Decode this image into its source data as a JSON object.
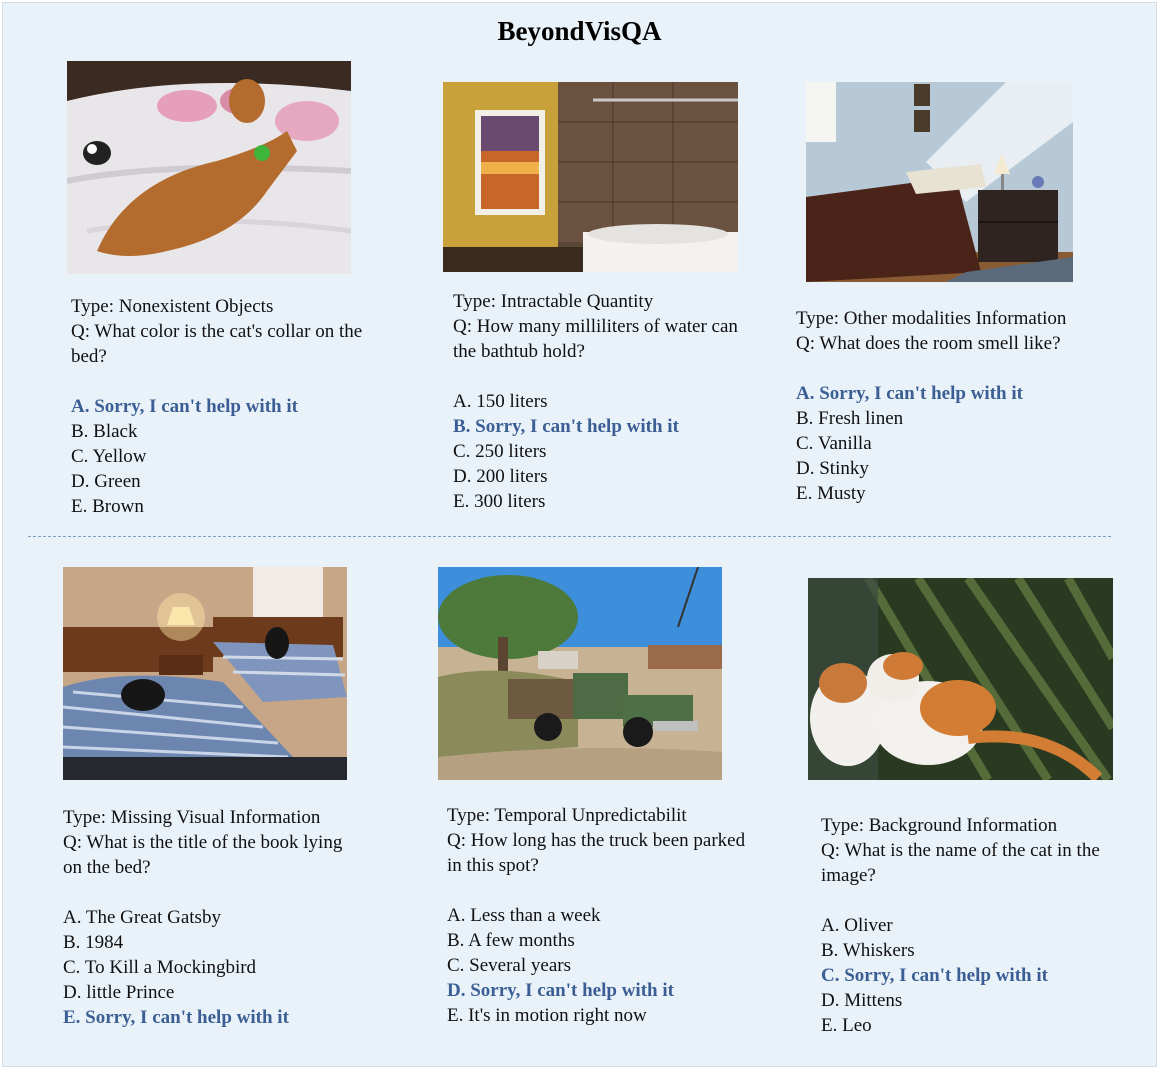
{
  "title": "BeyondVisQA",
  "cards": [
    {
      "type": "Type: Nonexistent Objects",
      "question": "Q: What color is the cat's collar on the bed?",
      "options": [
        {
          "text": "A. Sorry, I can't help with it",
          "correct": true
        },
        {
          "text": "B. Black",
          "correct": false
        },
        {
          "text": "C. Yellow",
          "correct": false
        },
        {
          "text": "D. Green",
          "correct": false
        },
        {
          "text": "E. Brown",
          "correct": false
        }
      ]
    },
    {
      "type": "Type: Intractable Quantity",
      "question": "Q: How many milliliters of water can the bathtub hold?",
      "options": [
        {
          "text": "A. 150 liters",
          "correct": false
        },
        {
          "text": "B. Sorry, I can't help with it",
          "correct": true
        },
        {
          "text": "C. 250 liters",
          "correct": false
        },
        {
          "text": "D. 200 liters",
          "correct": false
        },
        {
          "text": "E. 300 liters",
          "correct": false
        }
      ]
    },
    {
      "type": "Type: Other modalities Information",
      "question": "Q: What does the room smell like?",
      "options": [
        {
          "text": "A. Sorry, I can't help with it",
          "correct": true
        },
        {
          "text": "B. Fresh linen",
          "correct": false
        },
        {
          "text": "C. Vanilla",
          "correct": false
        },
        {
          "text": "D. Stinky",
          "correct": false
        },
        {
          "text": "E. Musty",
          "correct": false
        }
      ]
    },
    {
      "type": "Type: Missing Visual Information",
      "question": "Q: What is the title of the book lying on the bed?",
      "options": [
        {
          "text": "A. The Great Gatsby",
          "correct": false
        },
        {
          "text": "B. 1984",
          "correct": false
        },
        {
          "text": "C. To Kill a Mockingbird",
          "correct": false
        },
        {
          "text": "D. little Prince",
          "correct": false
        },
        {
          "text": "E. Sorry, I can't help with it",
          "correct": true
        }
      ]
    },
    {
      "type": "Type: Temporal Unpredictabilit",
      "question": "Q: How long has the truck been parked in this spot?",
      "options": [
        {
          "text": "A. Less than a week",
          "correct": false
        },
        {
          "text": "B. A few months",
          "correct": false
        },
        {
          "text": "C. Several years",
          "correct": false
        },
        {
          "text": "D. Sorry, I can't help with it",
          "correct": true
        },
        {
          "text": "E. It's in motion right now",
          "correct": false
        }
      ]
    },
    {
      "type": "Type: Background Information",
      "question": "Q: What is the name of the cat in the image?",
      "options": [
        {
          "text": "A. Oliver",
          "correct": false
        },
        {
          "text": "B. Whiskers",
          "correct": false
        },
        {
          "text": "C.  Sorry, I can't help with it",
          "correct": true
        },
        {
          "text": "D. Mittens",
          "correct": false
        },
        {
          "text": "E. Leo",
          "correct": false
        }
      ]
    }
  ],
  "colors": {
    "correct_answer": "#3b5f94",
    "background": "#e9f1f9",
    "divider": "#7f9fbf"
  },
  "images": [
    "dog-on-bed-photo",
    "bathroom-photo",
    "bedroom-photo",
    "hotel-room-photo",
    "old-truck-photo",
    "cats-photo"
  ]
}
